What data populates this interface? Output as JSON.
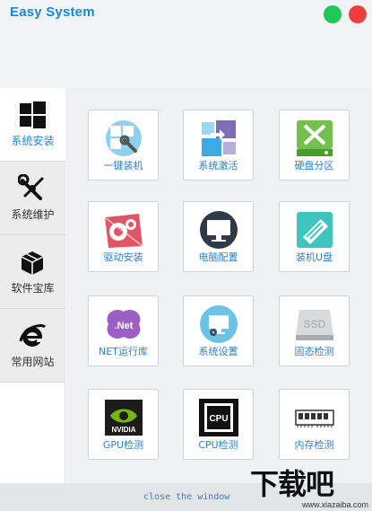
{
  "window": {
    "title": "Easy System"
  },
  "colors": {
    "accent": "#1a86d6",
    "min_dot": "#1ec95a",
    "close_dot": "#ee3d3d"
  },
  "sidebar": {
    "items": [
      {
        "label": "系统安装",
        "icon": "windows-icon",
        "active": true
      },
      {
        "label": "系统维护",
        "icon": "tools-icon",
        "active": false
      },
      {
        "label": "软件宝库",
        "icon": "box-icon",
        "active": false
      },
      {
        "label": "常用网站",
        "icon": "ie-icon",
        "active": false
      }
    ]
  },
  "tiles": [
    {
      "label": "一键装机",
      "icon": "one-click-install-icon"
    },
    {
      "label": "系统激活",
      "icon": "activate-icon"
    },
    {
      "label": "硬盘分区",
      "icon": "partition-icon"
    },
    {
      "label": "驱动安装",
      "icon": "driver-icon"
    },
    {
      "label": "电脑配置",
      "icon": "monitor-icon"
    },
    {
      "label": "装机U盘",
      "icon": "usb-icon"
    },
    {
      "label": "NET运行库",
      "icon": "dotnet-icon"
    },
    {
      "label": "系统设置",
      "icon": "settings-monitor-icon"
    },
    {
      "label": "固态检测",
      "icon": "ssd-icon"
    },
    {
      "label": "GPU检测",
      "icon": "gpu-icon"
    },
    {
      "label": "CPU检测",
      "icon": "cpu-icon"
    },
    {
      "label": "内存检测",
      "icon": "ram-icon"
    }
  ],
  "footer": {
    "close_text": "close the window"
  },
  "watermark": {
    "big": "下载吧",
    "small": "www.xiazaiba.com"
  }
}
